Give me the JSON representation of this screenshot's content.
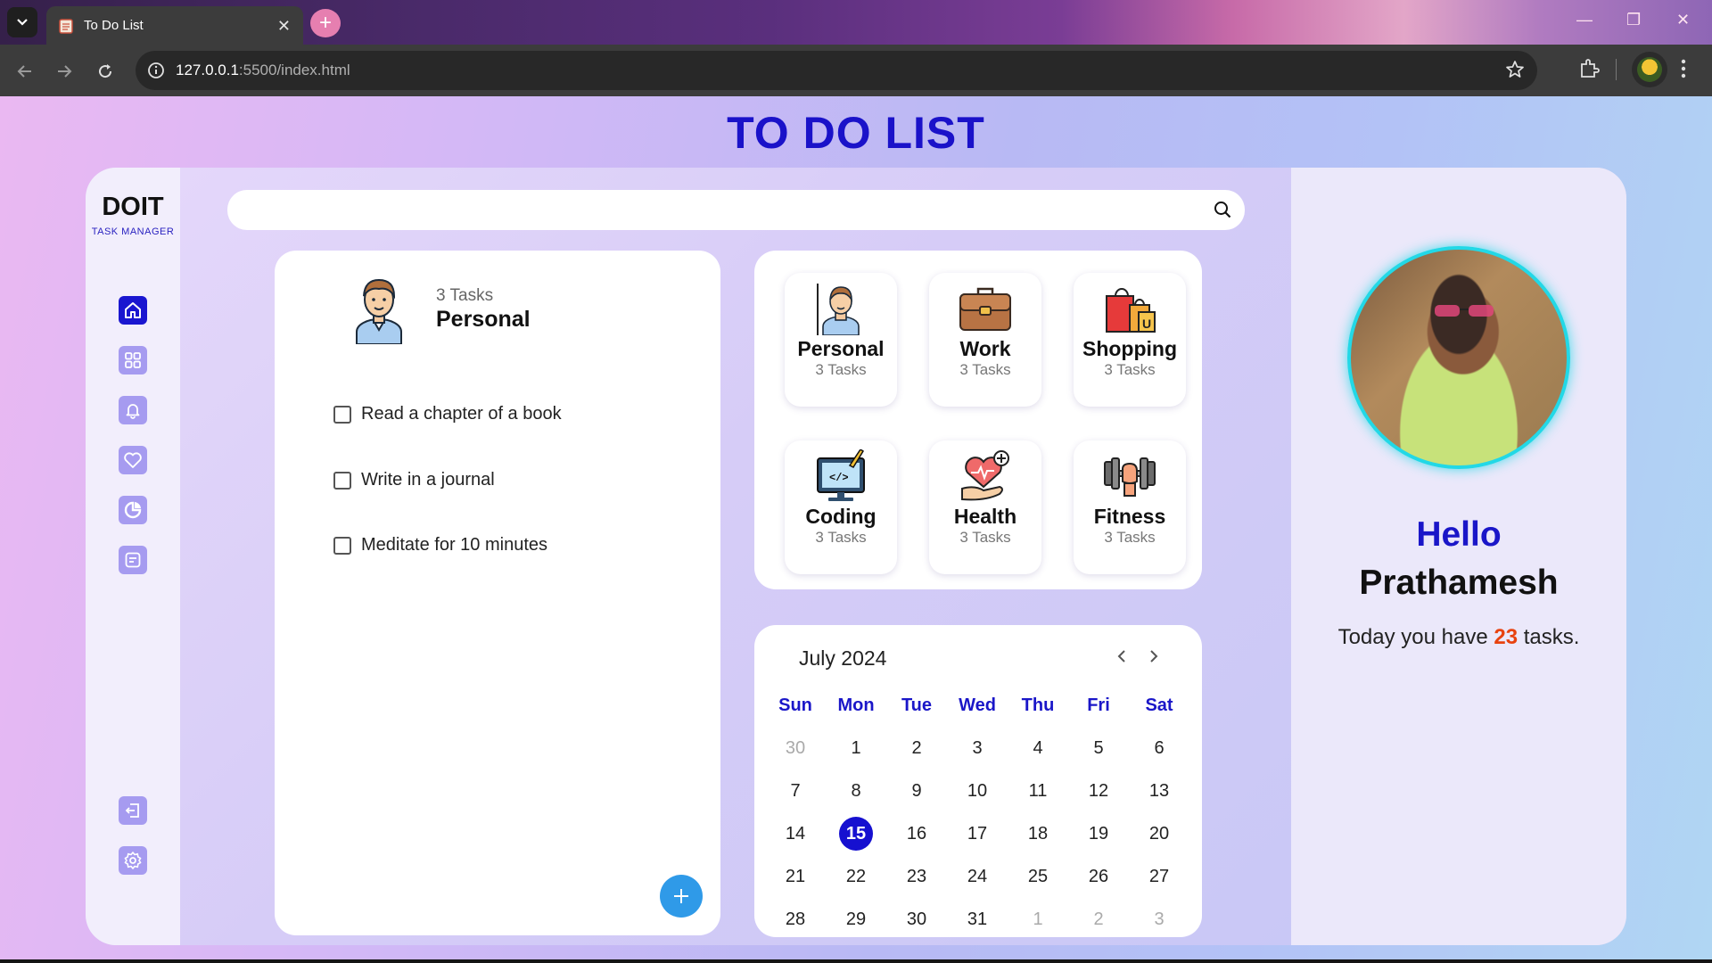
{
  "browser": {
    "tab_title": "To Do List",
    "url_host": "127.0.0.1",
    "url_rest": ":5500/index.html"
  },
  "page": {
    "title": "TO DO LIST"
  },
  "sidebar": {
    "logo": "DOIT",
    "logo_sub": "TASK MANAGER",
    "icons": [
      "home-icon",
      "grid-icon",
      "bell-icon",
      "heart-icon",
      "chart-icon",
      "notes-icon",
      "logout-icon",
      "settings-icon"
    ]
  },
  "search": {
    "placeholder": ""
  },
  "task_panel": {
    "count": "3 Tasks",
    "category": "Personal",
    "tasks": [
      "Read a chapter of a book",
      "Write in a journal",
      "Meditate for 10 minutes"
    ]
  },
  "categories": [
    {
      "name": "Personal",
      "count": "3 Tasks",
      "icon": "person-icon"
    },
    {
      "name": "Work",
      "count": "3 Tasks",
      "icon": "briefcase-icon"
    },
    {
      "name": "Shopping",
      "count": "3 Tasks",
      "icon": "shopping-bag-icon"
    },
    {
      "name": "Coding",
      "count": "3 Tasks",
      "icon": "monitor-code-icon"
    },
    {
      "name": "Health",
      "count": "3 Tasks",
      "icon": "heart-hand-icon"
    },
    {
      "name": "Fitness",
      "count": "3 Tasks",
      "icon": "dumbbell-icon"
    }
  ],
  "calendar": {
    "title": "July 2024",
    "weekdays": [
      "Sun",
      "Mon",
      "Tue",
      "Wed",
      "Thu",
      "Fri",
      "Sat"
    ],
    "weeks": [
      [
        "30",
        "1",
        "2",
        "3",
        "4",
        "5",
        "6"
      ],
      [
        "7",
        "8",
        "9",
        "10",
        "11",
        "12",
        "13"
      ],
      [
        "14",
        "15",
        "16",
        "17",
        "18",
        "19",
        "20"
      ],
      [
        "21",
        "22",
        "23",
        "24",
        "25",
        "26",
        "27"
      ],
      [
        "28",
        "29",
        "30",
        "31",
        "1",
        "2",
        "3"
      ]
    ],
    "today": "15"
  },
  "profile": {
    "hello": "Hello",
    "name": "Prathamesh",
    "today_prefix": "Today you have",
    "today_count": "23",
    "today_suffix": "tasks."
  },
  "colors": {
    "accent": "#1a16c8",
    "highlight": "#e8420f",
    "fab": "#2f9ae8",
    "avatar_ring": "#22d8e6"
  }
}
